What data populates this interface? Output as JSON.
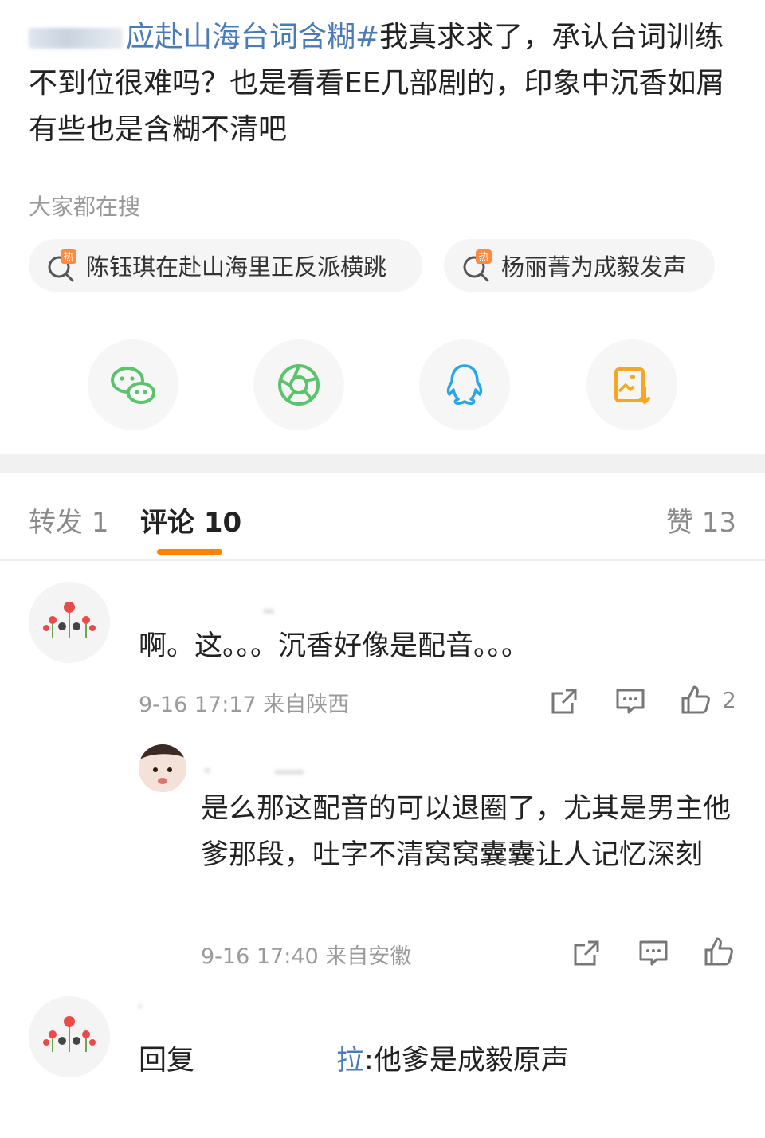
{
  "post": {
    "topic_visible": "应赴山海台词含糊#",
    "text": "我真求求了，承认台词训练不到位很难吗？也是看看EE几部剧的，印象中沉香如屑有些也是含糊不清吧"
  },
  "search": {
    "title": "大家都在搜",
    "chips": [
      "陈钰琪在赴山海里正反派横跳",
      "杨丽菁为成毅发声"
    ]
  },
  "share_icons": [
    "wechat-icon",
    "moments-icon",
    "qq-icon",
    "save-image-icon"
  ],
  "tabs": {
    "repost_label": "转发",
    "repost_count": "1",
    "comment_label": "评论",
    "comment_count": "10",
    "like_label": "赞",
    "like_count": "13"
  },
  "comments": [
    {
      "text": "啊。这。。。沉香好像是配音。。。",
      "time": "9-16 17:17",
      "location": "来自陕西",
      "likes": "2"
    },
    {
      "text": "是么那这配音的可以退圈了，尤其是男主他爹那段，吐字不清窝窝囊囊让人记忆深刻",
      "time": "9-16 17:40",
      "location": "来自安徽"
    },
    {
      "reply_prefix": "回复",
      "mention_tail": "拉",
      "text": ":他爹是成毅原声"
    }
  ],
  "colors": {
    "accent": "#ff8200",
    "link": "#4a7bb7",
    "wechat": "#5ac36c",
    "qq": "#2aa6e6",
    "save": "#f5a623"
  }
}
